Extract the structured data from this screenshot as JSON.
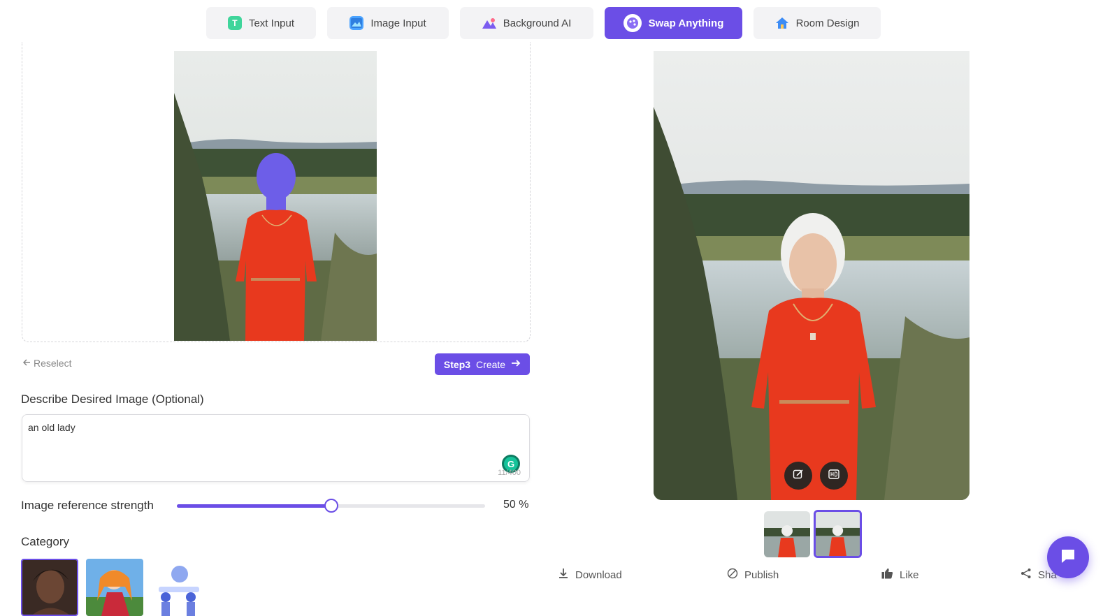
{
  "tabs": [
    {
      "label": "Text Input",
      "icon": "text-input-icon"
    },
    {
      "label": "Image Input",
      "icon": "image-input-icon"
    },
    {
      "label": "Background AI",
      "icon": "background-ai-icon"
    },
    {
      "label": "Swap Anything",
      "icon": "swap-anything-icon",
      "active": true
    },
    {
      "label": "Room Design",
      "icon": "room-design-icon"
    }
  ],
  "editor": {
    "reselect_label": "Reselect",
    "create_step": "Step3",
    "create_label": "Create",
    "describe_label": "Describe Desired Image (Optional)",
    "describe_value": "an old lady",
    "char_counter": "11/400",
    "strength_label": "Image reference strength",
    "strength_value": 50,
    "strength_display": "50 %",
    "category_label": "Category"
  },
  "actions": {
    "download": "Download",
    "publish": "Publish",
    "like": "Like",
    "share": "Sha"
  },
  "colors": {
    "accent": "#6b4ee6",
    "dress": "#e8391e",
    "mask": "#6d5ee8"
  }
}
